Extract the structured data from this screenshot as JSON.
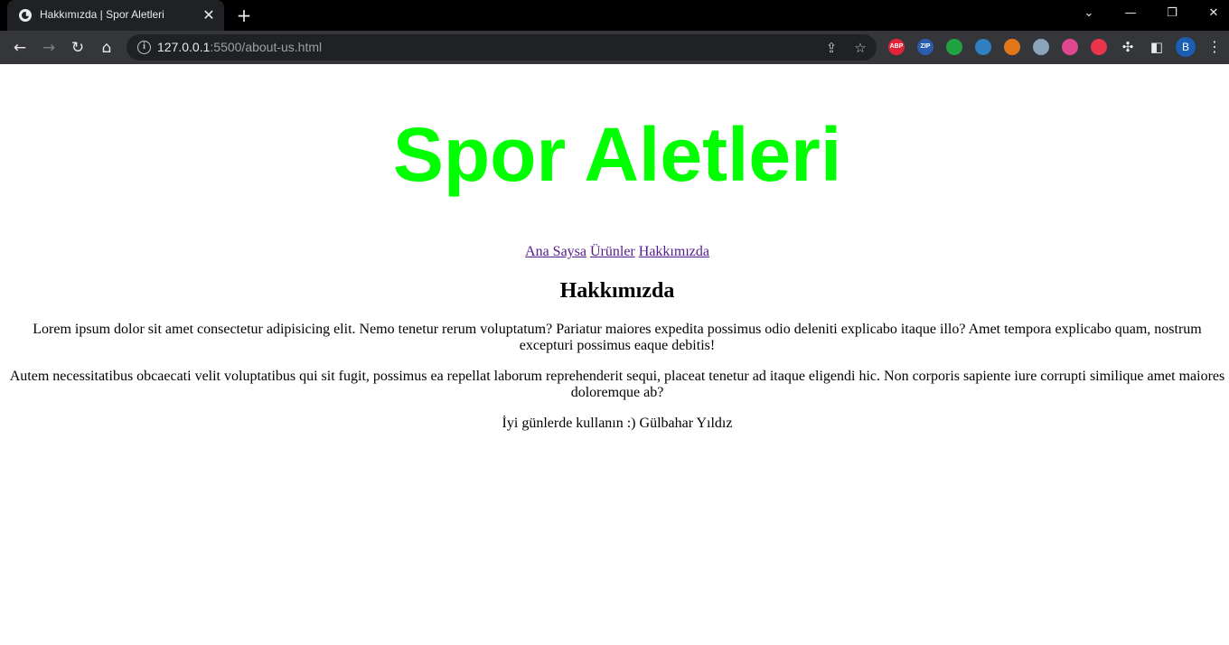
{
  "browser": {
    "tab_title": "Hakkımızda | Spor Aletleri",
    "url_host": "127.0.0.1",
    "url_rest": ":5500/about-us.html",
    "profile_initial": "B",
    "extensions": [
      {
        "name": "adblock-plus",
        "label": "ABP",
        "color": "#e0243a"
      },
      {
        "name": "zip-extension",
        "label": "ZIP",
        "color": "#2a5db0"
      },
      {
        "name": "evernote",
        "label": "",
        "color": "#1ea340"
      },
      {
        "name": "eye-extension",
        "label": "",
        "color": "#2f7fc1"
      },
      {
        "name": "metamask",
        "label": "",
        "color": "#e2761b"
      },
      {
        "name": "globe-extension",
        "label": "",
        "color": "#8aa4b8"
      },
      {
        "name": "color-extension",
        "label": "",
        "color": "#e0488e"
      },
      {
        "name": "screenshot-extension",
        "label": "",
        "color": "#e8334a"
      }
    ]
  },
  "page": {
    "site_title": "Spor Aletleri",
    "nav": [
      "Ana Saysa",
      "Ürünler",
      "Hakkımızda"
    ],
    "heading": "Hakkımızda",
    "paragraphs": [
      "Lorem ipsum dolor sit amet consectetur adipisicing elit. Nemo tenetur rerum voluptatum? Pariatur maiores expedita possimus odio deleniti explicabo itaque illo? Amet tempora explicabo quam, nostrum excepturi possimus eaque debitis!",
      "Autem necessitatibus obcaecati velit voluptatibus qui sit fugit, possimus ea repellat laborum reprehenderit sequi, placeat tenetur ad itaque eligendi hic. Non corporis sapiente iure corrupti similique amet maiores doloremque ab?",
      "İyi günlerde kullanın :) Gülbahar Yıldız"
    ],
    "title_color": "#00ff00",
    "link_color": "#551a8b"
  }
}
